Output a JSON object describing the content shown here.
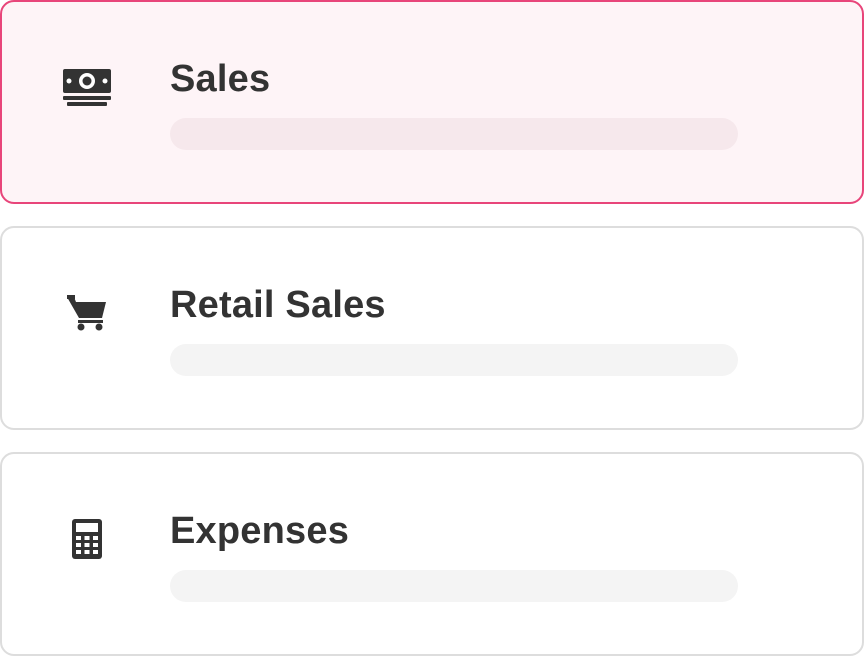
{
  "options": [
    {
      "id": "sales",
      "label": "Sales",
      "icon": "money-icon",
      "selected": true
    },
    {
      "id": "retail-sales",
      "label": "Retail Sales",
      "icon": "cart-icon",
      "selected": false
    },
    {
      "id": "expenses",
      "label": "Expenses",
      "icon": "calculator-icon",
      "selected": false
    }
  ],
  "colors": {
    "accent": "#e8457a",
    "selected_background": "#fef4f7",
    "border": "#dddddd",
    "text": "#333333",
    "placeholder_bar": "#f4f4f4"
  }
}
